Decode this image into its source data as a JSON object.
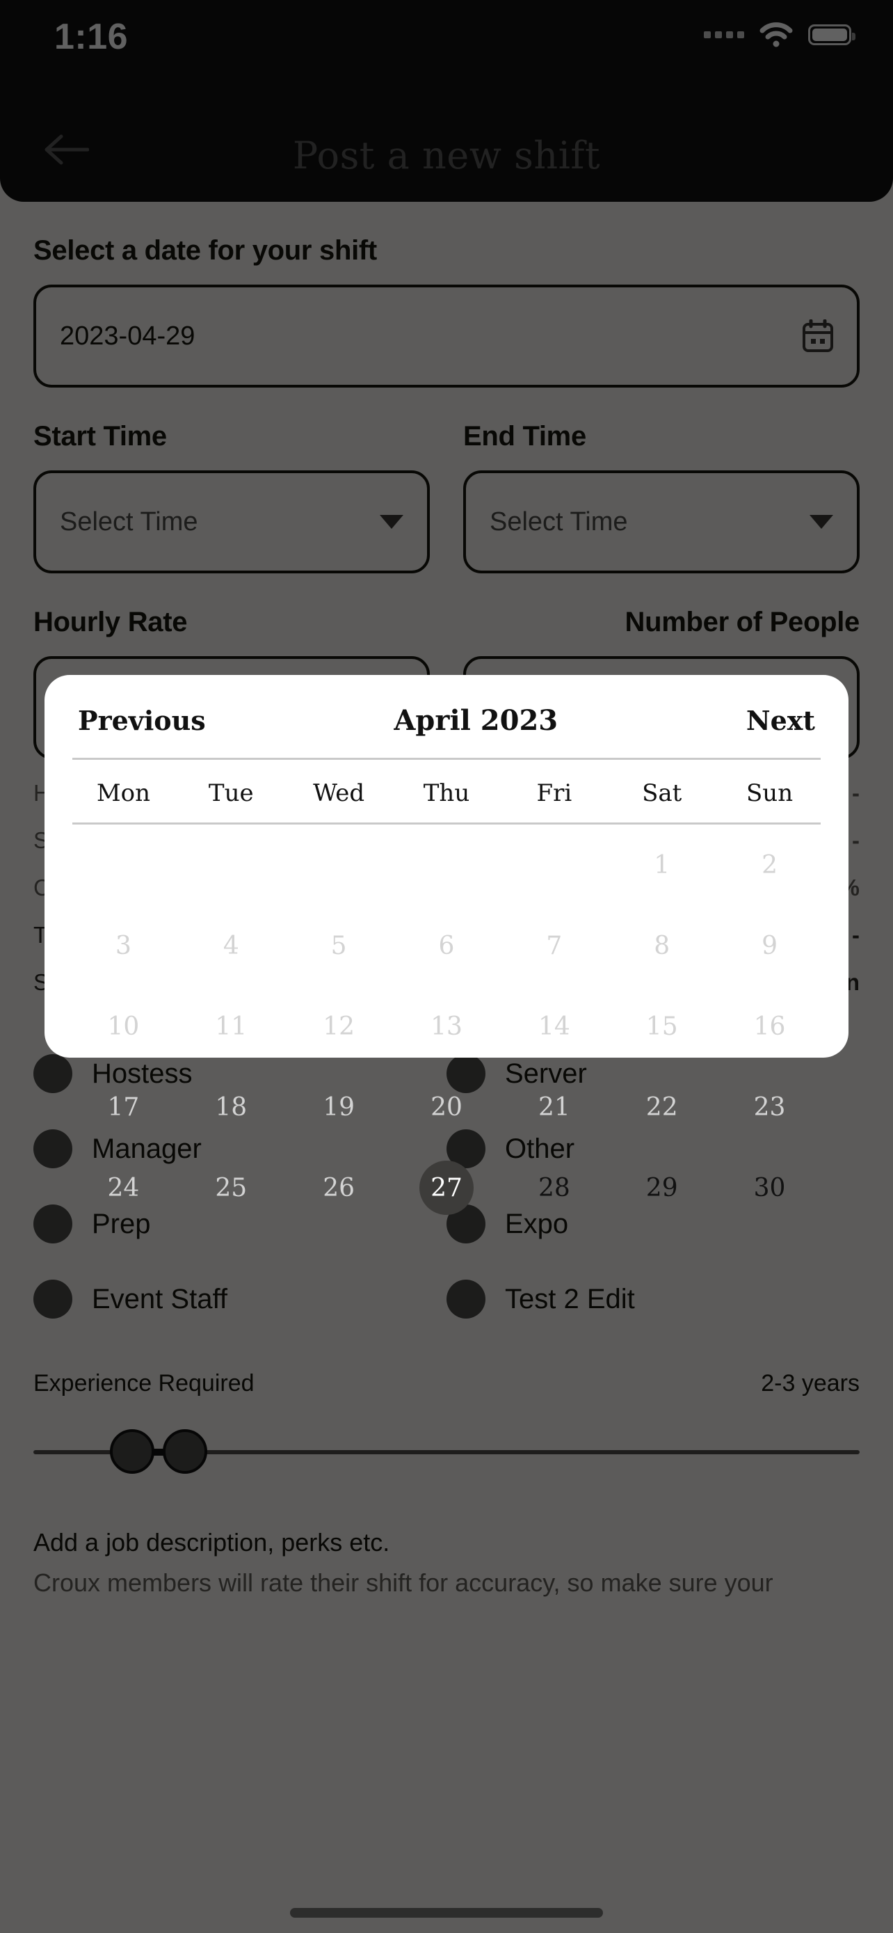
{
  "status_bar": {
    "time": "1:16",
    "cellular_icon": "cellular-dots-icon",
    "wifi_icon": "wifi-icon",
    "battery_icon": "battery-icon"
  },
  "header": {
    "title": "Post a new shift",
    "back_icon": "back-arrow-icon"
  },
  "form": {
    "date_label": "Select a date for your shift",
    "date_value": "2023-04-29",
    "date_icon": "calendar-icon",
    "start_time_label": "Start Time",
    "start_time_placeholder": "Select Time",
    "end_time_label": "End Time",
    "end_time_placeholder": "Select Time",
    "hourly_rate_label": "Hourly Rate",
    "number_of_people_label": "Number of People",
    "hidden_line_1": "H",
    "hidden_line_2": "S",
    "hidden_line_3": "C",
    "hidden_line_4": "T",
    "hidden_line_5": "S",
    "hidden_right_1": "-",
    "hidden_right_2": "-",
    "hidden_right_3": "%",
    "hidden_right_4": "-",
    "hidden_right_5": "n"
  },
  "roles": [
    {
      "left": "Hostess",
      "right": "Server"
    },
    {
      "left": "Manager",
      "right": "Other"
    },
    {
      "left": "Prep",
      "right": "Expo"
    },
    {
      "left": "Event Staff",
      "right": "Test 2 Edit"
    }
  ],
  "experience": {
    "label": "Experience Required",
    "value": "2-3 years",
    "thumb_low_icon": "slider-thumb-low",
    "thumb_high_icon": "slider-thumb-high"
  },
  "description": {
    "title": "Add a job description, perks etc.",
    "body": "Croux members will rate their shift for accuracy, so make sure your"
  },
  "calendar": {
    "previous_label": "Previous",
    "month_label": "April 2023",
    "next_label": "Next",
    "weekdays": [
      "Mon",
      "Tue",
      "Wed",
      "Thu",
      "Fri",
      "Sat",
      "Sun"
    ],
    "selected_day": 27,
    "weeks": [
      [
        {
          "day": "",
          "state": "empty"
        },
        {
          "day": "",
          "state": "empty"
        },
        {
          "day": "",
          "state": "empty"
        },
        {
          "day": "",
          "state": "empty"
        },
        {
          "day": "",
          "state": "empty"
        },
        {
          "day": "1",
          "state": "disabled"
        },
        {
          "day": "2",
          "state": "disabled"
        }
      ],
      [
        {
          "day": "3",
          "state": "disabled"
        },
        {
          "day": "4",
          "state": "disabled"
        },
        {
          "day": "5",
          "state": "disabled"
        },
        {
          "day": "6",
          "state": "disabled"
        },
        {
          "day": "7",
          "state": "disabled"
        },
        {
          "day": "8",
          "state": "disabled"
        },
        {
          "day": "9",
          "state": "disabled"
        }
      ],
      [
        {
          "day": "10",
          "state": "disabled"
        },
        {
          "day": "11",
          "state": "disabled"
        },
        {
          "day": "12",
          "state": "disabled"
        },
        {
          "day": "13",
          "state": "disabled"
        },
        {
          "day": "14",
          "state": "disabled"
        },
        {
          "day": "15",
          "state": "disabled"
        },
        {
          "day": "16",
          "state": "disabled"
        }
      ],
      [
        {
          "day": "17",
          "state": "disabled"
        },
        {
          "day": "18",
          "state": "disabled"
        },
        {
          "day": "19",
          "state": "disabled"
        },
        {
          "day": "20",
          "state": "disabled"
        },
        {
          "day": "21",
          "state": "disabled"
        },
        {
          "day": "22",
          "state": "disabled"
        },
        {
          "day": "23",
          "state": "disabled"
        }
      ],
      [
        {
          "day": "24",
          "state": "disabled"
        },
        {
          "day": "25",
          "state": "disabled"
        },
        {
          "day": "26",
          "state": "disabled"
        },
        {
          "day": "27",
          "state": "selected"
        },
        {
          "day": "28",
          "state": "enabled"
        },
        {
          "day": "29",
          "state": "enabled"
        },
        {
          "day": "30",
          "state": "enabled"
        }
      ]
    ]
  },
  "colors": {
    "modal_bg": "#ffffff",
    "selected_day_bg": "#3d3c3a",
    "nav_bg": "#111110",
    "page_bg": "#f2f0ec",
    "disabled_day": "#d3d3d3"
  }
}
